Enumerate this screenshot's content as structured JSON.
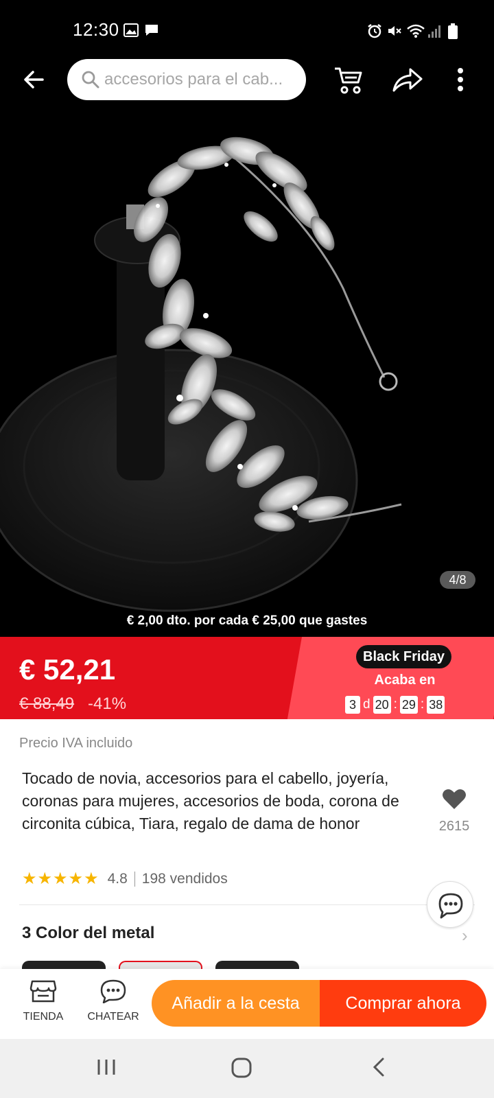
{
  "status_bar": {
    "time": "12:30",
    "icons": [
      "gallery-icon",
      "message-icon",
      "alarm-icon",
      "mute-icon",
      "wifi-icon",
      "signal-icon",
      "battery-icon"
    ]
  },
  "search": {
    "value": "accesorios para el cab..."
  },
  "toolbar_icons": [
    "back-arrow-icon",
    "cart-icon",
    "share-icon",
    "more-vertical-icon"
  ],
  "gallery": {
    "counter": "4/8",
    "promo": "€ 2,00 dto. por cada € 25,00 que gastes"
  },
  "pricing": {
    "price": "€ 52,21",
    "original_price": "€ 88,49",
    "discount": "-41%",
    "event_badge": "Black Friday",
    "ends_label": "Acaba en",
    "countdown": {
      "days": "3",
      "days_unit": "d",
      "hours": "20",
      "minutes": "29",
      "seconds": "38"
    }
  },
  "details": {
    "tax_note": "Precio IVA incluido",
    "title": "Tocado de novia, accesorios para el cabello, joyería, coronas para mujeres, accesorios de boda, corona de circonita cúbica, Tiara, regalo de dama de honor",
    "wishlist_count": "2615",
    "stars": "★★★★★",
    "rating": "4.8",
    "sold": "198 vendidos"
  },
  "variants": {
    "title": "3 Color del metal",
    "arrow": "›"
  },
  "bottom_bar": {
    "store_label": "TIENDA",
    "chat_label": "CHATEAR",
    "add_to_cart": "Añadir a la cesta",
    "buy_now": "Comprar ahora"
  },
  "colors": {
    "price_red": "#e3101c",
    "add_orange": "#ff9223",
    "buy_orange": "#ff3c0f",
    "star_yellow": "#f7b500"
  }
}
